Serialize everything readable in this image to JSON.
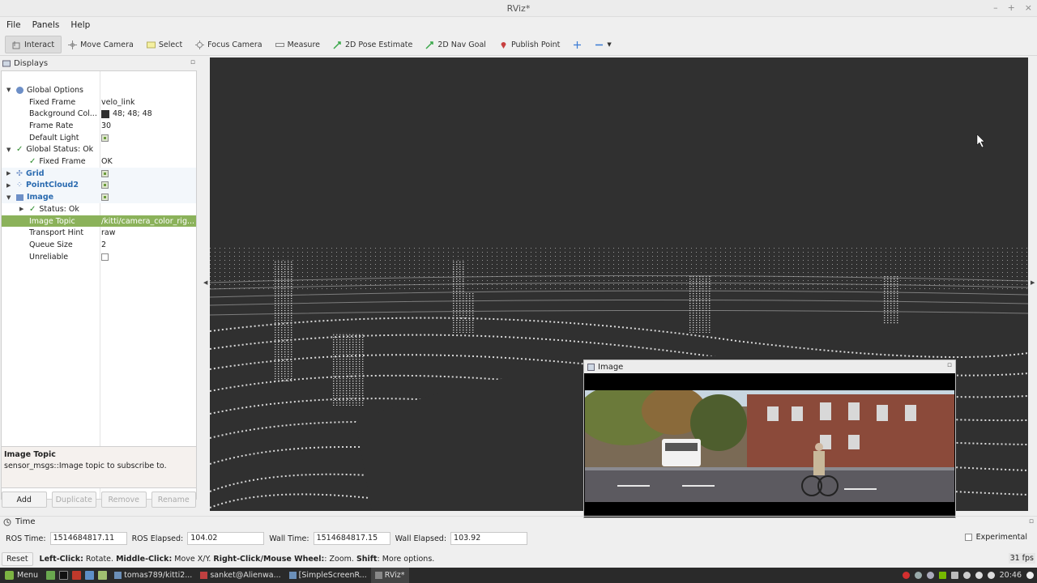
{
  "window": {
    "title": "RViz*"
  },
  "menubar": [
    "File",
    "Panels",
    "Help"
  ],
  "toolbar": {
    "tools": [
      "Interact",
      "Move Camera",
      "Select",
      "Focus Camera",
      "Measure",
      "2D Pose Estimate",
      "2D Nav Goal",
      "Publish Point"
    ]
  },
  "displays": {
    "title": "Displays",
    "rows": [
      {
        "name": "Global Options",
        "value": ""
      },
      {
        "name": "Fixed Frame",
        "value": "velo_link"
      },
      {
        "name": "Background Col...",
        "value": "48; 48; 48"
      },
      {
        "name": "Frame Rate",
        "value": "30"
      },
      {
        "name": "Default Light",
        "value": ""
      },
      {
        "name": "Global Status: Ok",
        "value": ""
      },
      {
        "name": "Fixed Frame",
        "value": "OK"
      },
      {
        "name": "Grid",
        "value": ""
      },
      {
        "name": "PointCloud2",
        "value": ""
      },
      {
        "name": "Image",
        "value": ""
      },
      {
        "name": "Status: Ok",
        "value": ""
      },
      {
        "name": "Image Topic",
        "value": "/kitti/camera_color_rig..."
      },
      {
        "name": "Transport Hint",
        "value": "raw"
      },
      {
        "name": "Queue Size",
        "value": "2"
      },
      {
        "name": "Unreliable",
        "value": ""
      }
    ],
    "description": {
      "title": "Image Topic",
      "text": "sensor_msgs::Image topic to subscribe to."
    },
    "buttons": [
      "Add",
      "Duplicate",
      "Remove",
      "Rename"
    ]
  },
  "image_window": {
    "title": "Image"
  },
  "time": {
    "title": "Time",
    "ros_time_label": "ROS Time:",
    "ros_time": "1514684817.11",
    "ros_elapsed_label": "ROS Elapsed:",
    "ros_elapsed": "104.02",
    "wall_time_label": "Wall Time:",
    "wall_time": "1514684817.15",
    "wall_elapsed_label": "Wall Elapsed:",
    "wall_elapsed": "103.92",
    "experimental": "Experimental"
  },
  "status": {
    "reset": "Reset",
    "hint_k1": "Left-Click:",
    "hint_v1": " Rotate. ",
    "hint_k2": "Middle-Click:",
    "hint_v2": " Move X/Y. ",
    "hint_k3": "Right-Click/Mouse Wheel:",
    "hint_v3": ": Zoom. ",
    "hint_k4": "Shift",
    "hint_v4": ": More options.",
    "fps": "31 fps"
  },
  "taskbar": {
    "menu": "Menu",
    "tasks": [
      "tomas789/kitti2...",
      "sanket@Alienwa...",
      "[SimpleScreenR...",
      "RViz*"
    ],
    "clock": "20:46"
  }
}
